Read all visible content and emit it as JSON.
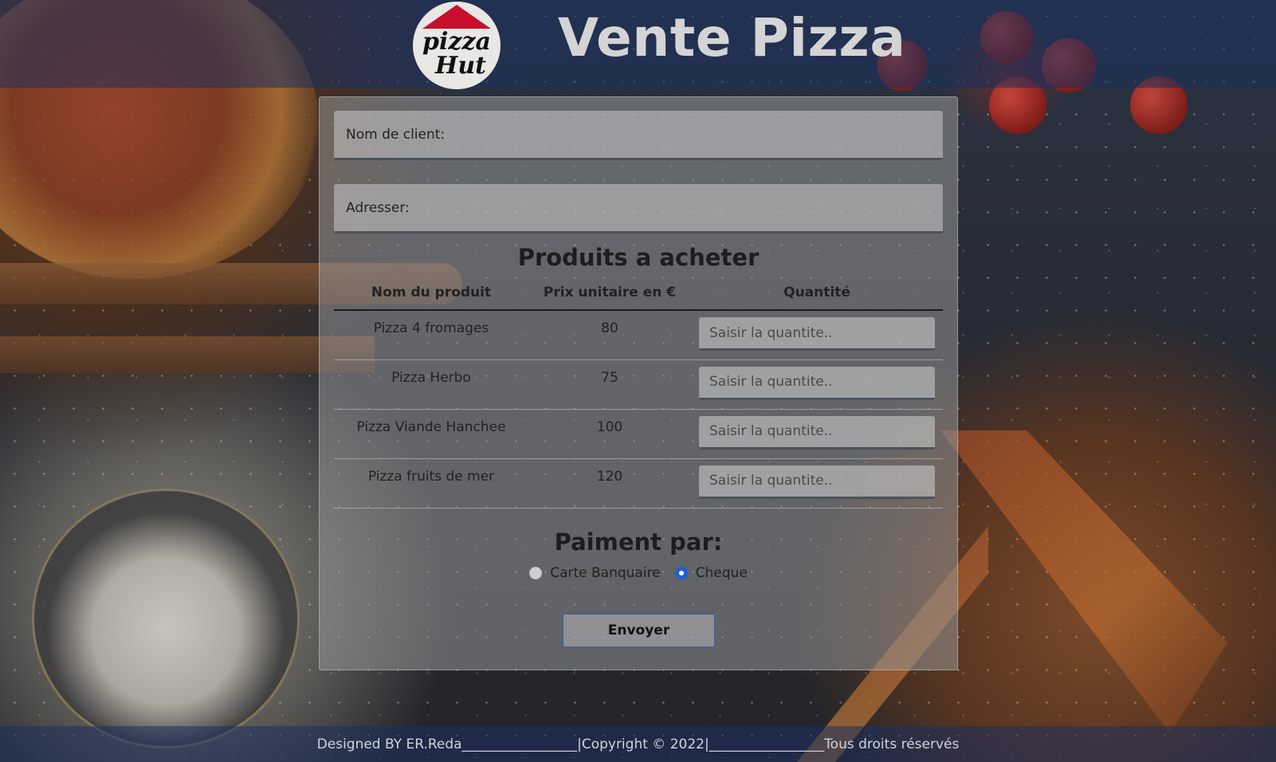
{
  "header": {
    "logo_line1": "pizza",
    "logo_line2": "Hut",
    "title": "Vente Pizza"
  },
  "form": {
    "name_placeholder": "Nom de client:",
    "address_placeholder": "Adresser:",
    "products_title": "Produits a acheter",
    "columns": [
      "Nom du produit",
      "Prix unitaire en €",
      "Quantité"
    ],
    "products": [
      {
        "name": "Pizza 4 fromages",
        "price": "80"
      },
      {
        "name": "Pizza Herbo",
        "price": "75"
      },
      {
        "name": "Pizza Viande Hanchee",
        "price": "100"
      },
      {
        "name": "Pizza fruits de mer",
        "price": "120"
      }
    ],
    "quantity_placeholder": "Saisir la quantite..",
    "payment_title": "Paiment par:",
    "payment_options": [
      {
        "label": "Carte Banquaire",
        "checked": false
      },
      {
        "label": "Cheque",
        "checked": true
      }
    ],
    "submit_label": "Envoyer"
  },
  "footer": {
    "text": "Designed BY ER.Reda_________________|Copyright © 2022|_________________Tous droits réservés"
  },
  "colors": {
    "accent": "#1f5fd6",
    "header_band": "#1c305f",
    "logo_red": "#c8102e"
  }
}
